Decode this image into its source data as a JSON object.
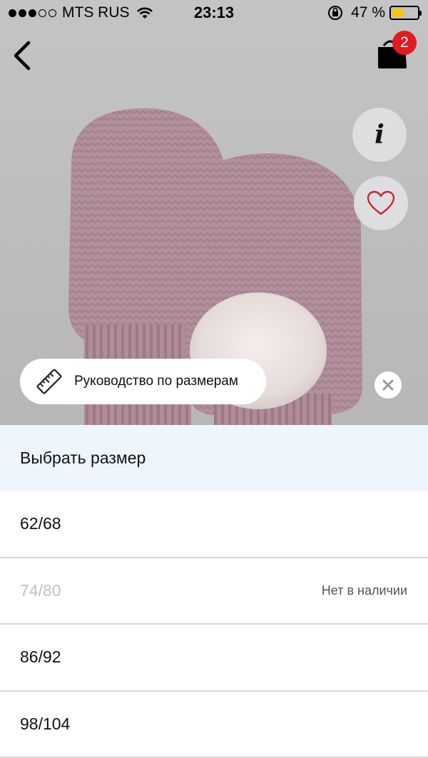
{
  "status_bar": {
    "carrier": "MTS RUS",
    "time": "23:13",
    "battery_percent": "47 %",
    "battery_level": 0.47,
    "signal_bars": 3
  },
  "header": {
    "back_icon": "chevron-left-icon",
    "cart_icon": "shopping-bag-icon",
    "cart_count": "2"
  },
  "product_actions": {
    "info_label": "i",
    "favorite_icon": "heart-outline-icon"
  },
  "size_guide": {
    "label": "Руководство по размерам",
    "icon": "ruler-icon",
    "close_icon": "close-icon"
  },
  "size_picker": {
    "title": "Выбрать размер",
    "options": [
      {
        "label": "62/68",
        "availability": ""
      },
      {
        "label": "74/80",
        "availability": "Нет в наличии"
      },
      {
        "label": "86/92",
        "availability": ""
      },
      {
        "label": "98/104",
        "availability": ""
      }
    ]
  },
  "colors": {
    "accent": "#e11b22",
    "sheet_header_bg": "#eef5fd",
    "battery": "#f5c518"
  }
}
